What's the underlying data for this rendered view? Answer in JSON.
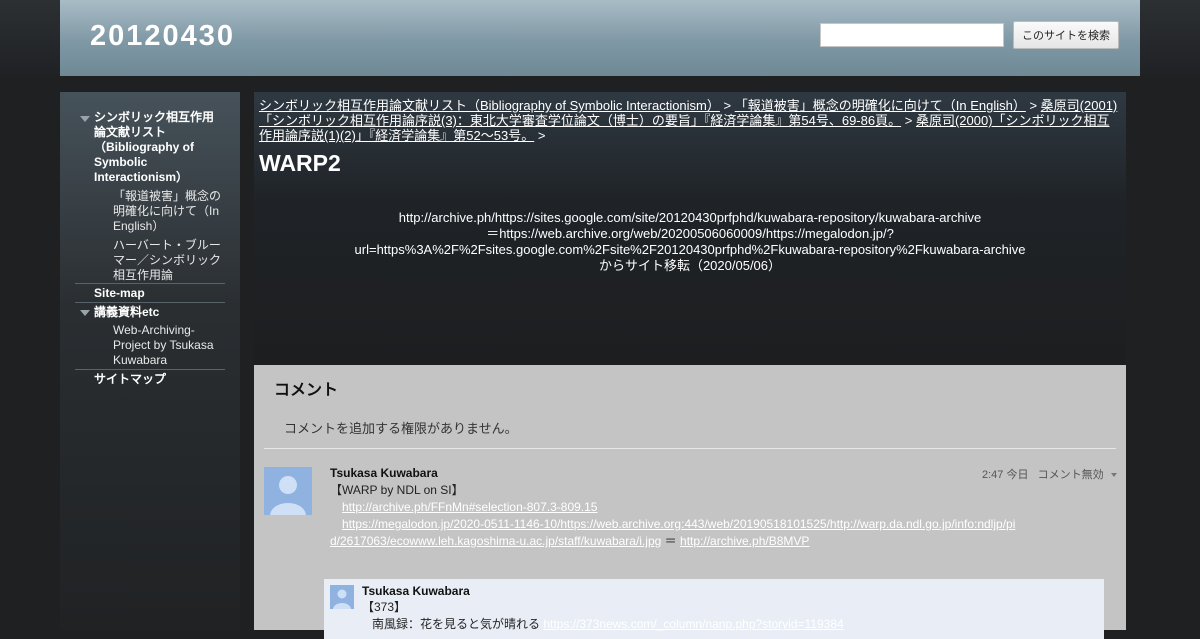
{
  "header": {
    "site_title": "20120430",
    "search_button": "このサイトを検索",
    "search_value": ""
  },
  "sidebar": {
    "item1": "シンボリック相互作用論文献リスト（Bibliography of Symbolic Interactionism）",
    "item1_sub1": "「報道被害」概念の明確化に向けて（In English）",
    "item1_sub2": "ハーバート・ブルーマー／シンボリック相互作用論",
    "item2": "Site-map",
    "item3": "講義資料etc",
    "item3_sub1": "Web-Archiving-Project by Tsukasa Kuwabara",
    "item4": "サイトマップ"
  },
  "breadcrumb": {
    "link1": "シンボリック相互作用論文献リスト（Bibliography of Symbolic Interactionism）",
    "link2": "「報道被害」概念の明確化に向けて（In English）",
    "link3": "桑原司(2001)「シンボリック相互作用論序説(3)：東北大学審査学位論文（博士）の要旨」『経済学論集』第54号、69-86頁。",
    "link4": "桑原司(2000)「シンボリック相互作用論序説(1)(2)」『経済学論集』第52～53号。",
    "sep": ">"
  },
  "page": {
    "title": "WARP2",
    "body_line1": "http://archive.ph/https://sites.google.com/site/20120430prfphd/kuwabara-repository/kuwabara-archive",
    "body_line2": "＝https://web.archive.org/web/20200506060009/https://megalodon.jp/?url=https%3A%2F%2Fsites.google.com%2Fsite%2F20120430prfphd%2Fkuwabara-repository%2Fkuwabara-archive",
    "body_line3": "からサイト移転（2020/05/06）"
  },
  "comments": {
    "title": "コメント",
    "permission": "コメントを追加する権限がありません。",
    "c1_author": "Tsukasa Kuwabara",
    "c1_time": "2:47 今日",
    "c1_disable": "コメント無効",
    "c1_line1": "【WARP by NDL on SI】",
    "c1_link1": "http://archive.ph/FFnMn#selection-807.3-809.15",
    "c1_link2": "https://megalodon.jp/2020-0511-1146-10/https://web.archive.org:443/web/20190518101525/http://warp.da.ndl.go.jp/info:ndljp/pid/2617063/ecowww.leh.kagoshima-u.ac.jp/staff/kuwabara/i.jpg",
    "c1_eq": "＝",
    "c1_link3": "http://archive.ph/B8MVP",
    "reply_author": "Tsukasa Kuwabara",
    "reply_line1": "【373】",
    "reply_line2": "南風録：花を見ると気が晴れる",
    "reply_link": "https://373news.com/_column/nanp.php?storyid=119384"
  }
}
